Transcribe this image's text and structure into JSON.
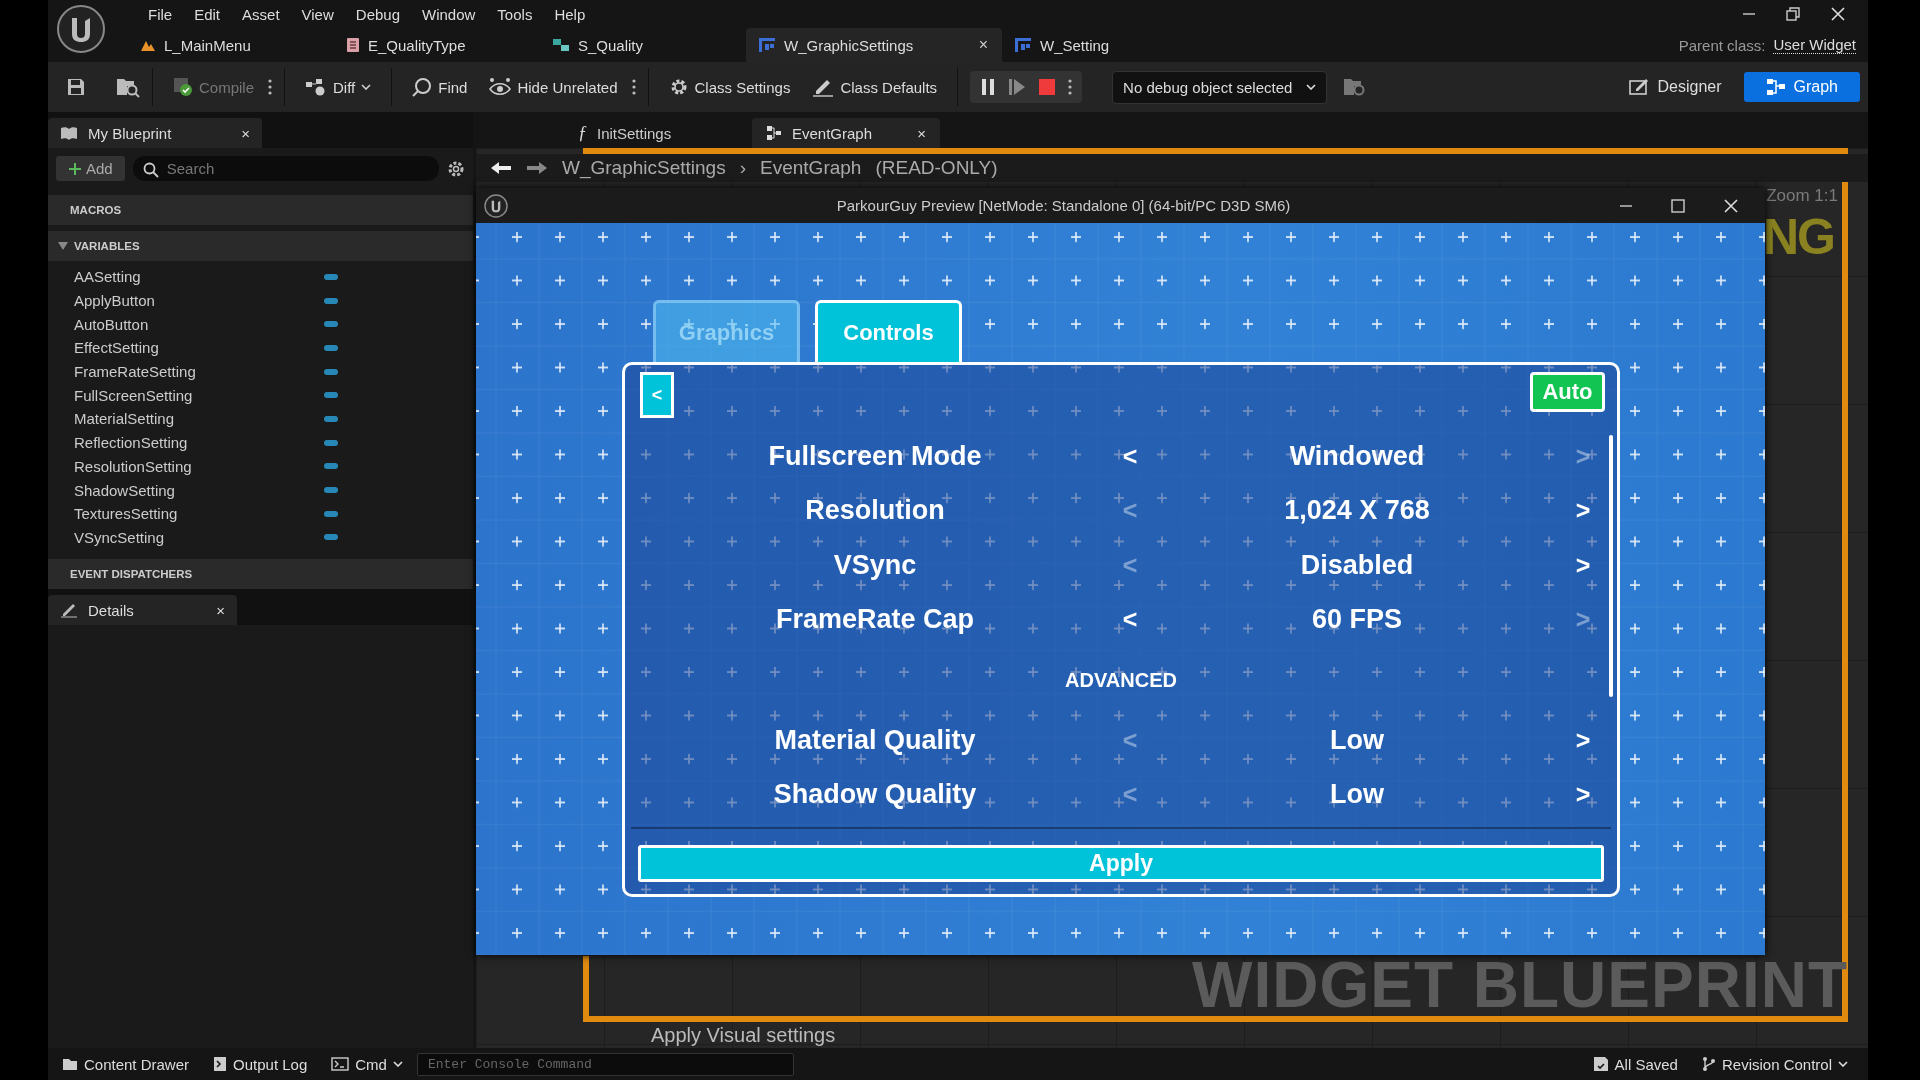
{
  "menu": [
    "File",
    "Edit",
    "Asset",
    "View",
    "Debug",
    "Window",
    "Tools",
    "Help"
  ],
  "doc_tabs": [
    {
      "label": "L_MainMenu",
      "kind": "level",
      "selected": false
    },
    {
      "label": "E_QualityType",
      "kind": "enum",
      "selected": false
    },
    {
      "label": "S_Quality",
      "kind": "struct",
      "selected": false
    },
    {
      "label": "W_GraphicSettings",
      "kind": "widget",
      "selected": true,
      "close": "×"
    },
    {
      "label": "W_Setting",
      "kind": "widget",
      "selected": false
    }
  ],
  "parent_class": {
    "label": "Parent class:",
    "value": "User Widget"
  },
  "toolbar": {
    "compile": {
      "label": "Compile",
      "disabled": true
    },
    "diff": "Diff",
    "find": "Find",
    "hide_unrelated": "Hide Unrelated",
    "class_settings": "Class Settings",
    "class_defaults": "Class Defaults",
    "debug_select": "No debug object selected",
    "modes": [
      {
        "label": "Designer",
        "selected": false
      },
      {
        "label": "Graph",
        "selected": true
      }
    ]
  },
  "my_blueprint": {
    "tab": "My Blueprint",
    "close": "×",
    "add": "Add",
    "search_placeholder": "Search",
    "macros": "MACROS",
    "variables": {
      "title": "VARIABLES",
      "expanded": true,
      "items": [
        "AASetting",
        "ApplyButton",
        "AutoButton",
        "EffectSetting",
        "FrameRateSetting",
        "FullScreenSetting",
        "MaterialSetting",
        "ReflectionSetting",
        "ResolutionSetting",
        "ShadowSetting",
        "TexturesSetting",
        "VSyncSetting"
      ]
    },
    "event_dispatchers": "EVENT DISPATCHERS"
  },
  "details": {
    "tab": "Details",
    "close": "×"
  },
  "graph_tabs": [
    {
      "label": "InitSettings",
      "kind": "function",
      "icon": "ƒ",
      "selected": false
    },
    {
      "label": "EventGraph",
      "kind": "graph",
      "selected": true,
      "close": "×"
    }
  ],
  "breadcrumb": {
    "blueprint": "W_GraphicSettings",
    "separator": "›",
    "graph": "EventGraph",
    "mode": "(READ-ONLY)"
  },
  "graph": {
    "zoom": "Zoom 1:1",
    "corner_text": "NG",
    "watermark": "WIDGET BLUEPRINT",
    "comment": "Apply Visual settings"
  },
  "preview": {
    "title": "ParkourGuy Preview [NetMode: Standalone 0]  (64-bit/PC D3D SM6)",
    "tabs": [
      {
        "label": "Graphics",
        "disabled": true
      },
      {
        "label": "Controls",
        "disabled": false
      }
    ],
    "back": "<",
    "auto": "Auto",
    "settings": [
      {
        "kind": "row",
        "label": "Fullscreen Mode",
        "value": "Windowed",
        "prev": {
          "text": "<",
          "disabled": false
        },
        "next": {
          "text": ">",
          "disabled": true
        }
      },
      {
        "kind": "row",
        "label": "Resolution",
        "value": "1,024 X 768",
        "prev": {
          "text": "<",
          "disabled": true
        },
        "next": {
          "text": ">",
          "disabled": false
        }
      },
      {
        "kind": "row",
        "label": "VSync",
        "value": "Disabled",
        "prev": {
          "text": "<",
          "disabled": true
        },
        "next": {
          "text": ">",
          "disabled": false
        }
      },
      {
        "kind": "row",
        "label": "FrameRate Cap",
        "value": "60 FPS",
        "prev": {
          "text": "<",
          "disabled": false
        },
        "next": {
          "text": ">",
          "disabled": true
        }
      },
      {
        "kind": "heading",
        "label": "ADVANCED"
      },
      {
        "kind": "row",
        "label": "Material Quality",
        "value": "Low",
        "prev": {
          "text": "<",
          "disabled": true
        },
        "next": {
          "text": ">",
          "disabled": false
        }
      },
      {
        "kind": "row",
        "label": "Shadow Quality",
        "value": "Low",
        "prev": {
          "text": "<",
          "disabled": true
        },
        "next": {
          "text": ">",
          "disabled": false
        }
      }
    ],
    "apply": "Apply"
  },
  "status_bar": {
    "content_drawer": "Content Drawer",
    "output_log": "Output Log",
    "cmd": "Cmd",
    "console_placeholder": "Enter Console Command",
    "all_saved": "All Saved",
    "revision_control": "Revision Control"
  }
}
